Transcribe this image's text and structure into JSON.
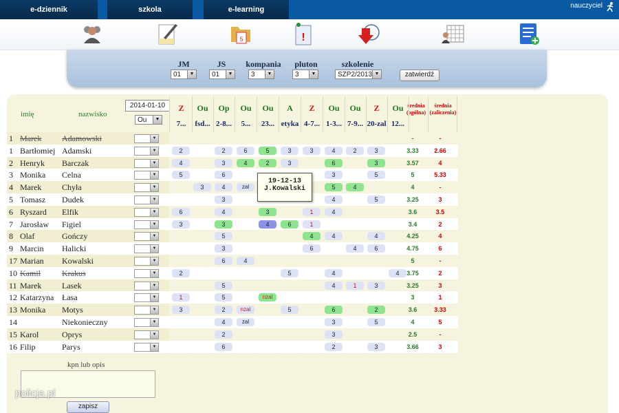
{
  "nav": {
    "tabs": [
      "e-dziennik",
      "szkola",
      "e-learning"
    ],
    "user": "nauczyciel"
  },
  "toolbar": {
    "icons": [
      "users-icon",
      "edit-document-icon",
      "calendar-folder-icon",
      "alert-document-icon",
      "download-arrow-icon",
      "grid-table-icon",
      "list-add-icon"
    ]
  },
  "filters": {
    "jm": {
      "label": "JM",
      "value": "01"
    },
    "js": {
      "label": "JS",
      "value": "01"
    },
    "kompania": {
      "label": "kompania",
      "value": "3"
    },
    "pluton": {
      "label": "pluton",
      "value": "3"
    },
    "szkolenie": {
      "label": "szkolenie",
      "value": "SZP2/2013"
    },
    "confirm_label": "zatwierdź"
  },
  "table": {
    "col_first_name": "imię",
    "col_last_name": "nazwisko",
    "date": "2014-01-10",
    "type_select": "Ou",
    "average_overall": "średnia (ogólna)",
    "average_pass": "średnia (zaliczenia)",
    "grade_columns": [
      {
        "top": "Z",
        "bottom": "7..."
      },
      {
        "top": "Ou",
        "bottom": "fsd..."
      },
      {
        "top": "Op",
        "bottom": "2-8..."
      },
      {
        "top": "Ou",
        "bottom": "5..."
      },
      {
        "top": "Ou",
        "bottom": "23..."
      },
      {
        "top": "A",
        "bottom": "etyka"
      },
      {
        "top": "Z",
        "bottom": "4-7..."
      },
      {
        "top": "Ou",
        "bottom": "1-3..."
      },
      {
        "top": "Ou",
        "bottom": "7-9..."
      },
      {
        "top": "Z",
        "bottom": "20-zal"
      },
      {
        "top": "Ou",
        "bottom": "12..."
      }
    ],
    "rows": [
      {
        "no": "1",
        "first": "Marek",
        "last": "Adamowski",
        "struck": true,
        "grades": [
          "",
          "",
          "",
          "",
          "",
          "",
          "",
          "",
          "",
          "",
          ""
        ],
        "avg": "-",
        "avg_pass": "-"
      },
      {
        "no": "1",
        "first": "Bartłomiej",
        "last": "Adamski",
        "grades": [
          "2",
          "",
          "2",
          "6",
          "5",
          "3",
          "3",
          "4",
          "2",
          "3",
          ""
        ],
        "avg": "3.33",
        "avg_pass": "2.66"
      },
      {
        "no": "2",
        "first": "Henryk",
        "last": "Barczak",
        "grades": [
          "4",
          "",
          "3",
          "4",
          "2",
          "3",
          "",
          "6",
          "",
          "3",
          ""
        ],
        "avg": "3.57",
        "avg_pass": "4"
      },
      {
        "no": "3",
        "first": "Monika",
        "last": "Celna",
        "grades": [
          "5",
          "",
          "6",
          "",
          "",
          "",
          "",
          "3",
          "",
          "5",
          ""
        ],
        "avg": "5",
        "avg_pass": "5.33"
      },
      {
        "no": "4",
        "first": "Marek",
        "last": "Chyła",
        "grades": [
          "",
          "3",
          "4",
          "zal",
          "",
          "",
          "",
          "5",
          "4",
          "",
          ""
        ],
        "avg": "4",
        "avg_pass": "-"
      },
      {
        "no": "5",
        "first": "Tomasz",
        "last": "Dudek",
        "grades": [
          "",
          "",
          "3",
          "",
          "",
          "",
          "",
          "4",
          "",
          "5",
          ""
        ],
        "avg": "3.25",
        "avg_pass": "3"
      },
      {
        "no": "6",
        "first": "Ryszard",
        "last": "Elfik",
        "grades": [
          "6",
          "",
          "4",
          "",
          "3",
          "",
          "1",
          "4",
          "",
          "",
          ""
        ],
        "avg": "3.6",
        "avg_pass": "3.5"
      },
      {
        "no": "7",
        "first": "Jarosław",
        "last": "Figiel",
        "grades": [
          "3",
          "",
          "3",
          "",
          "4",
          "6",
          "1",
          "",
          "",
          "",
          ""
        ],
        "avg": "3.4",
        "avg_pass": "2"
      },
      {
        "no": "8",
        "first": "Olaf",
        "last": "Gończy",
        "grades": [
          "",
          "",
          "5",
          "",
          "",
          "",
          "4",
          "4",
          "",
          "4",
          ""
        ],
        "avg": "4.25",
        "avg_pass": "4"
      },
      {
        "no": "9",
        "first": "Marcin",
        "last": "Halicki",
        "grades": [
          "",
          "",
          "3",
          "",
          "",
          "",
          "6",
          "",
          "4",
          "6",
          ""
        ],
        "avg": "4.75",
        "avg_pass": "6"
      },
      {
        "no": "17",
        "first": "Marian",
        "last": "Kowalski",
        "grades": [
          "",
          "",
          "6",
          "4",
          "",
          "",
          "",
          "",
          "",
          "",
          ""
        ],
        "avg": "5",
        "avg_pass": "-"
      },
      {
        "no": "10",
        "first": "Kamil",
        "last": "Krakus",
        "struck": true,
        "grades": [
          "2",
          "",
          "",
          "",
          "",
          "5",
          "",
          "4",
          "",
          "",
          "4"
        ],
        "avg": "3.75",
        "avg_pass": "2"
      },
      {
        "no": "11",
        "first": "Marek",
        "last": "Lasek",
        "grades": [
          "",
          "",
          "5",
          "",
          "",
          "",
          "",
          "4",
          "1",
          "3",
          ""
        ],
        "avg": "3.25",
        "avg_pass": "3"
      },
      {
        "no": "12",
        "first": "Katarzyna",
        "last": "Łasa",
        "grades": [
          "1",
          "",
          "5",
          "",
          "nzal",
          "",
          "",
          "",
          "",
          "",
          ""
        ],
        "avg": "3",
        "avg_pass": "1"
      },
      {
        "no": "13",
        "first": "Monika",
        "last": "Motys",
        "grades": [
          "3",
          "",
          "2",
          "nzal",
          "",
          "5",
          "",
          "6",
          "",
          "2",
          ""
        ],
        "avg": "3.6",
        "avg_pass": "3.33"
      },
      {
        "no": "14",
        "first": "",
        "last": "Niekonieczny",
        "grades": [
          "",
          "",
          "4",
          "zal",
          "",
          "",
          "",
          "3",
          "",
          "5",
          ""
        ],
        "avg": "4",
        "avg_pass": "5"
      },
      {
        "no": "15",
        "first": "Karol",
        "last": "Oprys",
        "grades": [
          "",
          "",
          "2",
          "",
          "",
          "",
          "",
          "3",
          "",
          "",
          ""
        ],
        "avg": "2.5",
        "avg_pass": "-"
      },
      {
        "no": "16",
        "first": "Filip",
        "last": "Parys",
        "grades": [
          "",
          "",
          "6",
          "",
          "",
          "",
          "",
          "2",
          "",
          "3",
          ""
        ],
        "avg": "3.66",
        "avg_pass": "3"
      }
    ],
    "green_cells": [
      "1-4",
      "2-3",
      "2-4",
      "2-7",
      "2-9",
      "4-7",
      "4-8",
      "6-4",
      "7-2",
      "7-5",
      "8-6",
      "13-4",
      "14-7",
      "14-9"
    ],
    "blue_cells": [
      "7-4"
    ],
    "red_cells": [
      "6-6",
      "7-6",
      "12-8",
      "13-0",
      "13-4",
      "14-3"
    ]
  },
  "tooltip": {
    "line1": "19-12-13",
    "line2": "J.Kowalski"
  },
  "description": {
    "label": "kpn lub opis",
    "save_label": "zapisz"
  },
  "watermark": "policja.pl"
}
